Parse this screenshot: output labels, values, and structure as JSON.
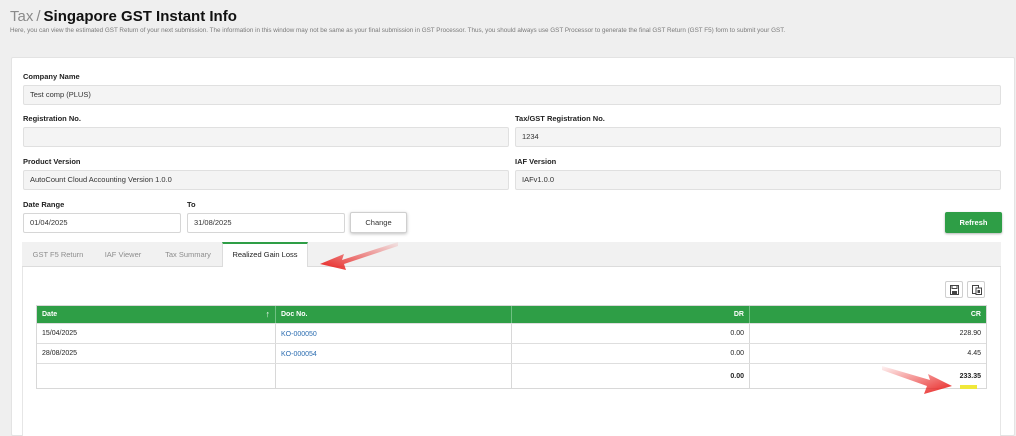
{
  "header": {
    "breadcrumb": "Tax",
    "separator": "/",
    "title": "Singapore GST Instant Info",
    "description": "Here, you can view the estimated GST Return of your next submission. The information in this window may not be same as your final submission in GST Processor. Thus, you should always use GST Processor to generate the final GST Return (GST F5) form to submit your GST."
  },
  "form": {
    "company_name_label": "Company Name",
    "company_name_value": "Test comp  (PLUS)",
    "registration_no_label": "Registration No.",
    "registration_no_value": "",
    "tax_reg_label": "Tax/GST Registration No.",
    "tax_reg_value": "1234",
    "product_version_label": "Product Version",
    "product_version_value": "AutoCount Cloud Accounting Version 1.0.0",
    "iaf_version_label": "IAF Version",
    "iaf_version_value": "IAFv1.0.0",
    "date_range_label": "Date Range",
    "date_from": "01/04/2025",
    "to_label": "To",
    "date_to": "31/08/2025",
    "change_button": "Change",
    "refresh_button": "Refresh"
  },
  "tabs": [
    {
      "label": "GST F5 Return",
      "active": false
    },
    {
      "label": "IAF Viewer",
      "active": false
    },
    {
      "label": "Tax Summary",
      "active": false
    },
    {
      "label": "Realized Gain Loss",
      "active": true
    }
  ],
  "toolbar": {
    "icons": [
      "save-icon",
      "export-icon"
    ]
  },
  "table": {
    "columns": [
      "Date",
      "Doc No.",
      "DR",
      "CR"
    ],
    "sort_indicator": "↑",
    "rows": [
      {
        "date": "15/04/2025",
        "doc_no": "KO-000050",
        "dr": "0.00",
        "cr": "228.90"
      },
      {
        "date": "28/08/2025",
        "doc_no": "KO-000054",
        "dr": "0.00",
        "cr": "4.45"
      }
    ],
    "totals": {
      "dr": "0.00",
      "cr": "233.35"
    }
  },
  "colors": {
    "accent": "#2e9e46",
    "link": "#2b6cb0",
    "annotation_arrow": "#e8201e",
    "highlight": "#f0e83a"
  }
}
